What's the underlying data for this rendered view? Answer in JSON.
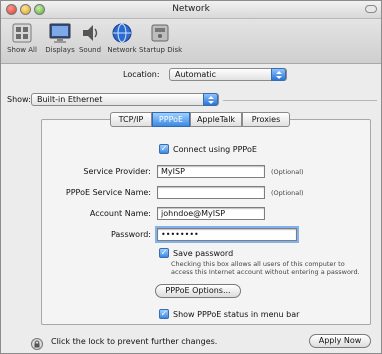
{
  "window": {
    "title": "Network"
  },
  "toolbar": {
    "items": [
      {
        "label": "Show All",
        "icon": "show-all-icon"
      },
      {
        "label": "Displays",
        "icon": "displays-icon"
      },
      {
        "label": "Sound",
        "icon": "sound-icon"
      },
      {
        "label": "Network",
        "icon": "network-icon"
      },
      {
        "label": "Startup Disk",
        "icon": "startup-disk-icon"
      }
    ]
  },
  "location": {
    "label": "Location:",
    "value": "Automatic"
  },
  "show": {
    "label": "Show:",
    "value": "Built-in Ethernet"
  },
  "tabs": [
    {
      "label": "TCP/IP",
      "selected": false
    },
    {
      "label": "PPPoE",
      "selected": true
    },
    {
      "label": "AppleTalk",
      "selected": false
    },
    {
      "label": "Proxies",
      "selected": false
    }
  ],
  "pppoe": {
    "connect_label": "Connect using PPPoE",
    "connect_checked": true,
    "service_provider_label": "Service Provider:",
    "service_provider_value": "MyISP",
    "service_provider_hint": "(Optional)",
    "service_name_label": "PPPoE Service Name:",
    "service_name_value": "",
    "service_name_hint": "(Optional)",
    "account_label": "Account Name:",
    "account_value": "johndoe@MyISP",
    "password_label": "Password:",
    "password_value": "••••••••",
    "save_password_label": "Save password",
    "save_password_checked": true,
    "save_password_note_1": "Checking this box allows all users of this computer to",
    "save_password_note_2": "access this Internet account without entering a password.",
    "options_button": "PPPoE Options...",
    "show_status_label": "Show PPPoE status in menu bar",
    "show_status_checked": true
  },
  "footer": {
    "lock_text": "Click the lock to prevent further changes.",
    "apply_button": "Apply Now"
  },
  "colors": {
    "accent": "#3d8ae3",
    "window_bg": "#ececec"
  }
}
